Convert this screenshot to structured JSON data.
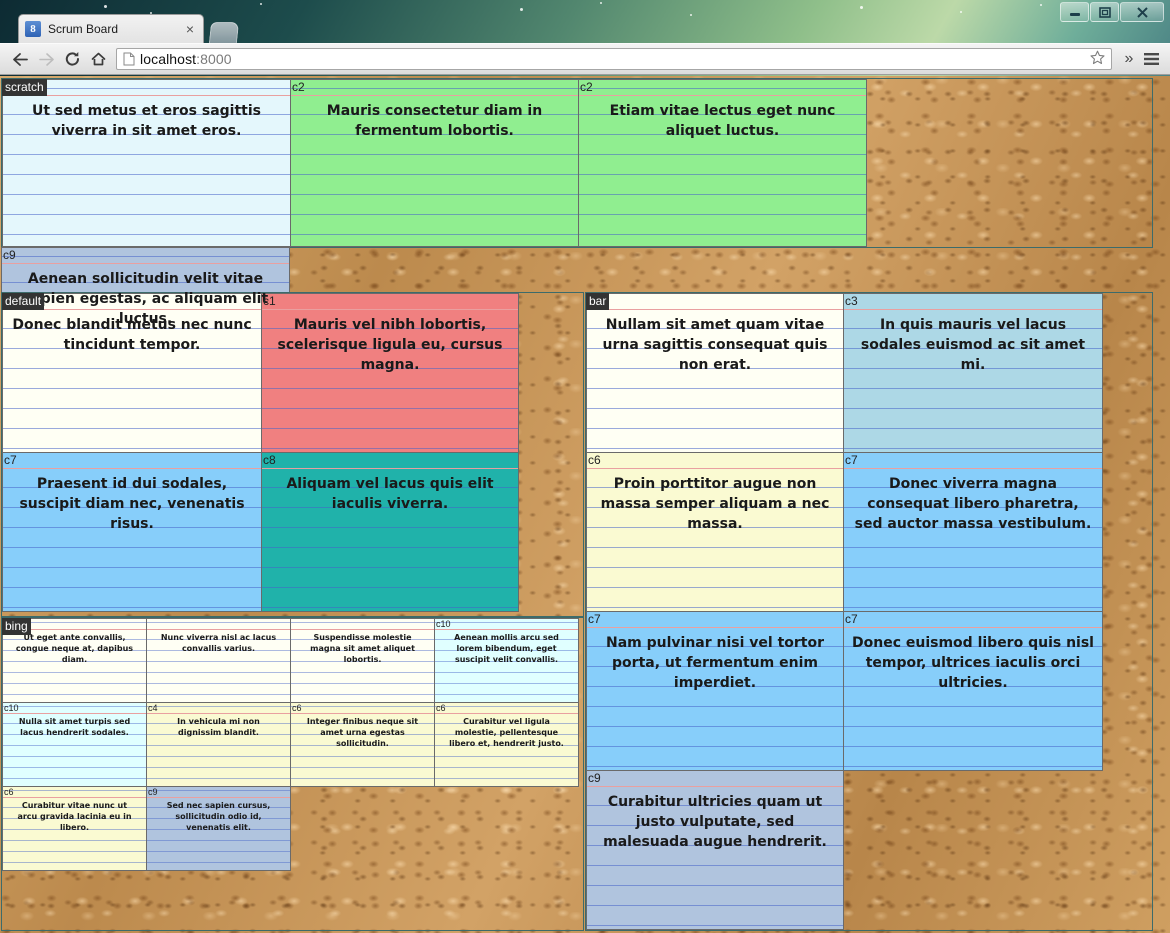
{
  "window": {
    "controls": {
      "minimize": "minimize-button",
      "maximize": "maximize-button",
      "close": "close-button"
    }
  },
  "browser": {
    "tab_title": "Scrum Board",
    "tab_favicon_letter": "8",
    "tab_close": "×",
    "back": "←",
    "forward": "→",
    "reload": "⟳",
    "home": "⌂",
    "url_host": "localhost",
    "url_port": ":8000",
    "url_full": "localhost:8000",
    "star": "☆",
    "overflow": "»",
    "menu": "☰"
  },
  "colors": {
    "cork": "#c79a5e",
    "board_border": "#3c6b6b",
    "label_bg": "#333333",
    "label_fg": "#ffffff",
    "c1": "#f08080",
    "c2": "#90ee90",
    "c3": "#add8e6",
    "c4": "#fafad2",
    "c6": "#fafad2",
    "c7": "#87cefa",
    "c8": "#20b2aa",
    "c9": "#b0c4de",
    "c10": "#e0ffff",
    "default": "#fffff4",
    "scratch": "#e4f7fc"
  },
  "boards": [
    {
      "name": "scratch",
      "label": "scratch",
      "cards": [
        {
          "id": "",
          "tag": "",
          "color_key": "scratch",
          "text": "Ut sed metus et eros sagittis viverra in sit amet eros."
        },
        {
          "id": "c2",
          "tag": "c2",
          "color_key": "c2",
          "text": "Mauris consectetur diam in fermentum lobortis."
        },
        {
          "id": "c2",
          "tag": "c2",
          "color_key": "c2",
          "text": "Etiam vitae lectus eget nunc aliquet luctus."
        },
        {
          "id": "c9",
          "tag": "c9",
          "color_key": "c9",
          "text": "Aenean sollicitudin velit vitae sapien egestas, ac aliquam elit luctus."
        }
      ]
    },
    {
      "name": "default",
      "label": "default",
      "cards": [
        {
          "id": "",
          "tag": "",
          "color_key": "default",
          "text": "Donec blandit metus nec nunc tincidunt tempor."
        },
        {
          "id": "c1",
          "tag": "c1",
          "color_key": "c1",
          "text": "Mauris vel nibh lobortis, scelerisque ligula eu, cursus magna."
        },
        {
          "id": "c7",
          "tag": "c7",
          "color_key": "c7",
          "text": "Praesent id dui sodales, suscipit diam nec, venenatis risus."
        },
        {
          "id": "c8",
          "tag": "c8",
          "color_key": "c8",
          "text": "Aliquam vel lacus quis elit iaculis viverra."
        }
      ]
    },
    {
      "name": "bing",
      "label": "bing",
      "cards": [
        {
          "id": "",
          "tag": "",
          "color_key": "default",
          "text": "Ut eget ante convallis, congue neque at, dapibus diam."
        },
        {
          "id": "",
          "tag": "",
          "color_key": "default",
          "text": "Nunc viverra nisl ac lacus convallis varius."
        },
        {
          "id": "",
          "tag": "",
          "color_key": "default",
          "text": "Suspendisse molestie magna sit amet aliquet lobortis."
        },
        {
          "id": "c10",
          "tag": "c10",
          "color_key": "c10",
          "text": "Aenean mollis arcu sed lorem bibendum, eget suscipit velit convallis."
        },
        {
          "id": "c10",
          "tag": "c10",
          "color_key": "c10",
          "text": "Nulla sit amet turpis sed lacus hendrerit sodales."
        },
        {
          "id": "c4",
          "tag": "c4",
          "color_key": "c4",
          "text": "In vehicula mi non dignissim blandit."
        },
        {
          "id": "c6",
          "tag": "c6",
          "color_key": "c6",
          "text": "Integer finibus neque sit amet urna egestas sollicitudin."
        },
        {
          "id": "c6",
          "tag": "c6",
          "color_key": "c6",
          "text": "Curabitur vel ligula molestie, pellentesque libero et, hendrerit justo."
        },
        {
          "id": "c6",
          "tag": "c6",
          "color_key": "c6",
          "text": "Curabitur vitae nunc ut arcu gravida lacinia eu in libero."
        },
        {
          "id": "c9",
          "tag": "c9",
          "color_key": "c9",
          "text": "Sed nec sapien cursus, sollicitudin odio id, venenatis elit."
        }
      ]
    },
    {
      "name": "bar",
      "label": "bar",
      "cards": [
        {
          "id": "",
          "tag": "",
          "color_key": "default",
          "text": "Nullam sit amet quam vitae urna sagittis consequat quis non erat."
        },
        {
          "id": "c3",
          "tag": "c3",
          "color_key": "c3",
          "text": "In quis mauris vel lacus sodales euismod ac sit amet mi."
        },
        {
          "id": "c6",
          "tag": "c6",
          "color_key": "c6",
          "text": "Proin porttitor augue non massa semper aliquam a nec massa."
        },
        {
          "id": "c7",
          "tag": "c7",
          "color_key": "c7",
          "text": "Donec viverra magna consequat libero pharetra, sed auctor massa vestibulum."
        },
        {
          "id": "c7",
          "tag": "c7",
          "color_key": "c7",
          "text": "Nam pulvinar nisi vel tortor porta, ut fermentum enim imperdiet."
        },
        {
          "id": "c7",
          "tag": "c7",
          "color_key": "c7",
          "text": "Donec euismod libero quis nisl tempor, ultrices iaculis orci ultricies."
        },
        {
          "id": "c9",
          "tag": "c9",
          "color_key": "c9",
          "text": "Curabitur ultricies quam ut justo vulputate, sed malesuada augue hendrerit."
        }
      ]
    }
  ]
}
